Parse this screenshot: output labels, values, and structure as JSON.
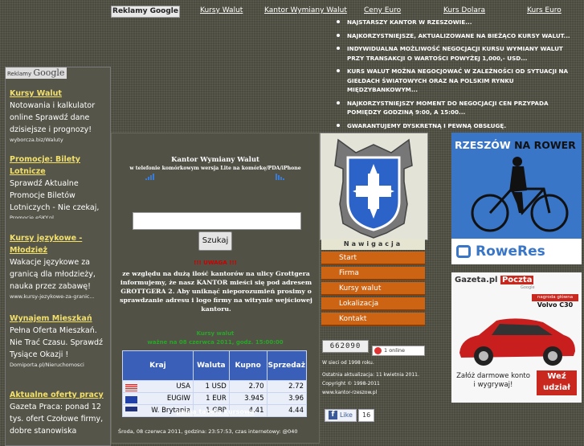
{
  "topnav": {
    "ads_button": "Reklamy Google",
    "links": [
      "Kursy Walut",
      "Kantor Wymiany Walut",
      "Ceny Euro",
      "Kurs Dolara",
      "Kurs Euro"
    ]
  },
  "bullets": [
    "NAJSTARSZY KANTOR W RZESZOWIE...",
    "NAJKORZYSTNIEJSZE, AKTUALIZOWANE NA BIEŻĄCO KURSY WALUT...",
    "INDYWIDUALNA MOŻLIWOŚĆ NEGOCJACJI KURSU WYMIANY WALUT PRZY TRANSAKCJI O WARTOŚCI POWYŻEJ 1,000,- USD...",
    "KURS WALUT MOŻNA NEGOCJOWAĆ W ZALEŻNOŚCI OD SYTUACJI NA GIEŁDACH ŚWIATOWYCH ORAZ NA POLSKIM RYNKU MIĘDZYBANKOWYM...",
    "NAJKORZYSTNIEJSZY MOMENT DO NEGOCJACJI CEN PRZYPADA POMIĘDZY GODZINĄ 9:00, A 15:00...",
    "GWARANTUJEMY DYSKRETNĄ I PEWNĄ OBSŁUGĘ."
  ],
  "leftbar": {
    "badge_small": "Reklamy",
    "badge_big": "Google",
    "ads": [
      {
        "title": "Kursy Walut",
        "desc": "Notowania i kalkulator online Sprawdź dane dzisiejsze i prognozy!",
        "url": "wyborcza.biz/Waluty"
      },
      {
        "title": "Promocje: Bilety Lotnicze",
        "desc": "Sprawdź Aktualne Promocje Biletów Lotniczych - Nie czekaj, Zarezerwuj",
        "url": "Promocje.eSKY.pl"
      },
      {
        "title": "Kursy językowe - Młodzież",
        "desc": "Wakacje językowe za granicą dla młodzieży, nauka przez zabawę!",
        "url": "www.kursy-jezykowe-za-granic..."
      },
      {
        "title": "Wynajem Mieszkań",
        "desc": "Pełna Oferta Mieszkań. Nie Trać Czasu. Sprawdź Tysiące Okazji !",
        "url": "Domiporta.pl/Nieruchomosci"
      },
      {
        "title": "Aktualne oferty pracy",
        "desc": "Gazeta Praca: ponad 12 tys. ofert Czołowe firmy, dobre stanowiska",
        "url": ""
      }
    ]
  },
  "center": {
    "title": "Kantor Wymiany Walut",
    "subtitle": "w telefonie komórkowym wersja Lite na komórkę/PDA/iPhone",
    "search_value": "",
    "search_button": "Szukaj",
    "red_line": "!!! UWAGA !!!",
    "notice": "ze względu na dużą ilość kantorów na ulicy Grottgera informujemy, że nasz KANTOR mieści się pod adresem GROTTGERA 2. Aby uniknąć nieporozumień prosimy o sprawdzanie adresu i logo firmy na witrynie wejściowej kantoru.",
    "green1": "Kursy walut",
    "green2": "ważne na 08 czerwca 2011, godz. 15:00:00",
    "table": {
      "headers": [
        "Kraj",
        "Waluta",
        "Kupno",
        "Sprzedaż"
      ],
      "rows": [
        {
          "flag": "us",
          "country": "USA",
          "currency": "1 USD",
          "buy": "2.70",
          "sell": "2.72"
        },
        {
          "flag": "eu",
          "country": "EUGIW",
          "currency": "1 EUR",
          "buy": "3.945",
          "sell": "3.96"
        },
        {
          "flag": "gb",
          "country": "W. Brytania",
          "currency": "1 GBP",
          "buy": "4.41",
          "sell": "4.44"
        }
      ]
    },
    "full_table_link": "pełna tabela kursowa",
    "datebar": "Środa, 08 czerwca 2011, godzina: 23:57:53, czas internetowy: @040"
  },
  "nav": {
    "header": "Nawigacja",
    "items": [
      "Start",
      "Firma",
      "Kursy walut",
      "Lokalizacja",
      "Kontakt"
    ]
  },
  "stats": {
    "counter": "662090",
    "online": "1 online",
    "since": "W sieci od 1998 roku.",
    "updated": "Ostatnia aktualizacja: 11 kwietnia 2011.",
    "copyright": "Copyright © 1998-2011",
    "domain": "www.kantor-rzeszow.pl"
  },
  "facebook": {
    "like": "Like",
    "count": "16"
  },
  "ads_right": {
    "bike_title_1": "RZESZÓW",
    "bike_title_2": "NA ROWER",
    "bike_brand": "RoweRes",
    "mail_title_1": "Gazeta.pl",
    "mail_title_2": "Poczta",
    "mail_google": "Google",
    "mail_prize_label": "nagroda główna",
    "mail_prize": "Volvo C30",
    "mail_cta_text": "Załóż darmowe konto i wygrywaj!",
    "mail_button": "Weź udział"
  },
  "colors": {
    "nav_orange": "#cc6414",
    "table_header": "#3a5fb8",
    "ad_title": "#f2e06a",
    "green": "#2ba62b",
    "warn_red": "#cc0000"
  }
}
